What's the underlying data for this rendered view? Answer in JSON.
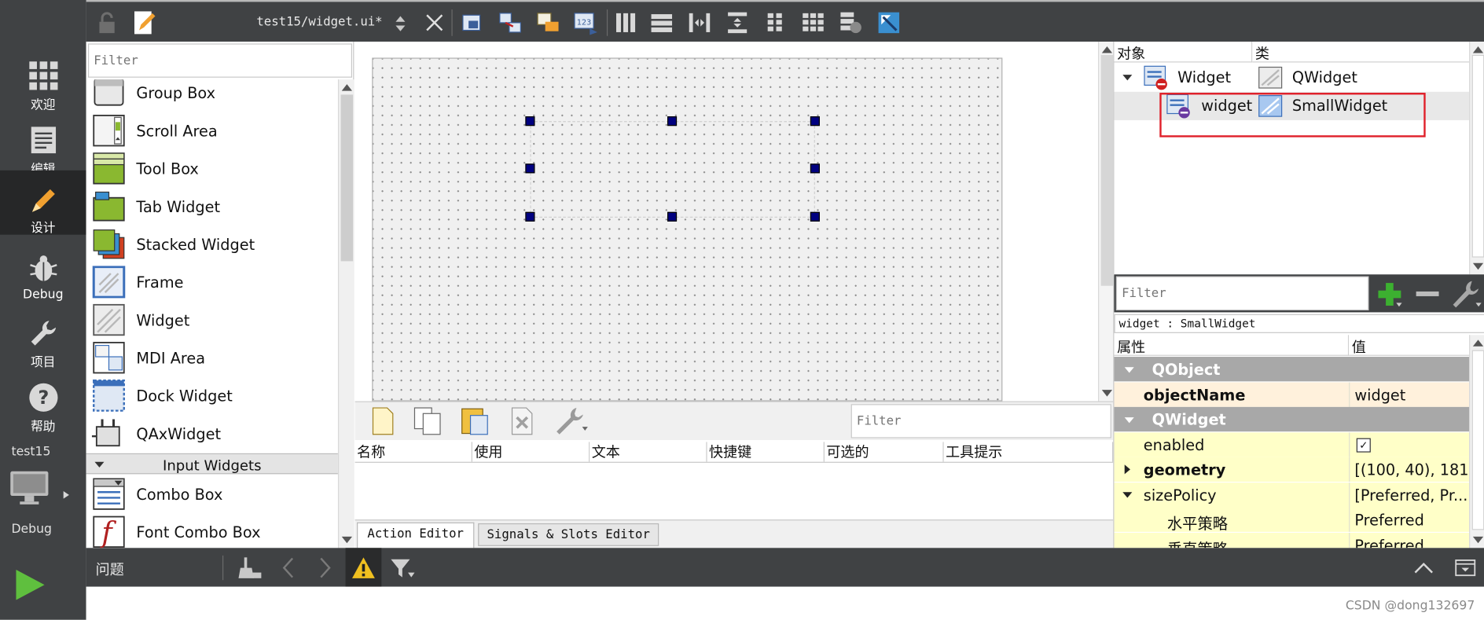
{
  "file": {
    "title": "test15/widget.ui*"
  },
  "modes": [
    {
      "label": "欢迎",
      "icon": "welcome-grid-icon"
    },
    {
      "label": "编辑",
      "icon": "edit-document-icon"
    },
    {
      "label": "设计",
      "icon": "design-pencil-icon"
    },
    {
      "label": "Debug",
      "icon": "debug-bug-icon"
    },
    {
      "label": "项目",
      "icon": "project-wrench-icon"
    },
    {
      "label": "帮助",
      "icon": "help-question-icon"
    }
  ],
  "kit": {
    "project": "test15",
    "build": "Debug"
  },
  "widgetbox": {
    "filter_placeholder": "Filter",
    "items": [
      {
        "label": "Group Box",
        "icon": "group-box-icon"
      },
      {
        "label": "Scroll Area",
        "icon": "scroll-area-icon"
      },
      {
        "label": "Tool Box",
        "icon": "tool-box-icon"
      },
      {
        "label": "Tab Widget",
        "icon": "tab-widget-icon"
      },
      {
        "label": "Stacked Widget",
        "icon": "stacked-widget-icon"
      },
      {
        "label": "Frame",
        "icon": "frame-icon"
      },
      {
        "label": "Widget",
        "icon": "widget-icon"
      },
      {
        "label": "MDI Area",
        "icon": "mdi-area-icon"
      },
      {
        "label": "Dock Widget",
        "icon": "dock-widget-icon"
      },
      {
        "label": "QAxWidget",
        "icon": "qaxwidget-icon"
      }
    ],
    "category": "Input Widgets",
    "items2": [
      {
        "label": "Combo Box",
        "icon": "combo-box-icon"
      },
      {
        "label": "Font Combo Box",
        "icon": "font-combo-box-icon"
      }
    ]
  },
  "action_editor": {
    "filter_placeholder": "Filter",
    "columns": [
      "名称",
      "使用",
      "文本",
      "快捷键",
      "可选的",
      "工具提示"
    ],
    "tabs": [
      "Action Editor",
      "Signals & Slots Editor"
    ]
  },
  "object_inspector": {
    "headers": [
      "对象",
      "类"
    ],
    "rows": [
      {
        "object": "Widget",
        "class": "QWidget"
      },
      {
        "object": "widget",
        "class": "SmallWidget"
      }
    ]
  },
  "property_editor": {
    "filter_placeholder": "Filter",
    "context": "widget : SmallWidget",
    "headers": [
      "属性",
      "值"
    ],
    "rows": [
      {
        "type": "group",
        "name": "QObject"
      },
      {
        "type": "peach",
        "name": "objectName",
        "value": "widget",
        "bold": true
      },
      {
        "type": "group",
        "name": "QWidget"
      },
      {
        "type": "yellow",
        "name": "enabled",
        "value": "✓",
        "checkbox": true
      },
      {
        "type": "yellow",
        "name": "geometry",
        "value": "[(100, 40), 181...",
        "bold": true,
        "expander": "collapsed"
      },
      {
        "type": "yellow",
        "name": "sizePolicy",
        "value": "[Preferred, Pr...",
        "expander": "expanded"
      },
      {
        "type": "yellow",
        "name": "水平策略",
        "value": "Preferred",
        "indent": true
      },
      {
        "type": "yellow",
        "name": "垂直策略",
        "value": "Preferred",
        "indent": true
      }
    ]
  },
  "issues": {
    "label": "问题"
  },
  "watermark": "CSDN @dong132697",
  "colors": {
    "sidebar": "#404244",
    "active_mode": "#262728",
    "highlight_box": "#e0202a",
    "handle": "#000080"
  }
}
